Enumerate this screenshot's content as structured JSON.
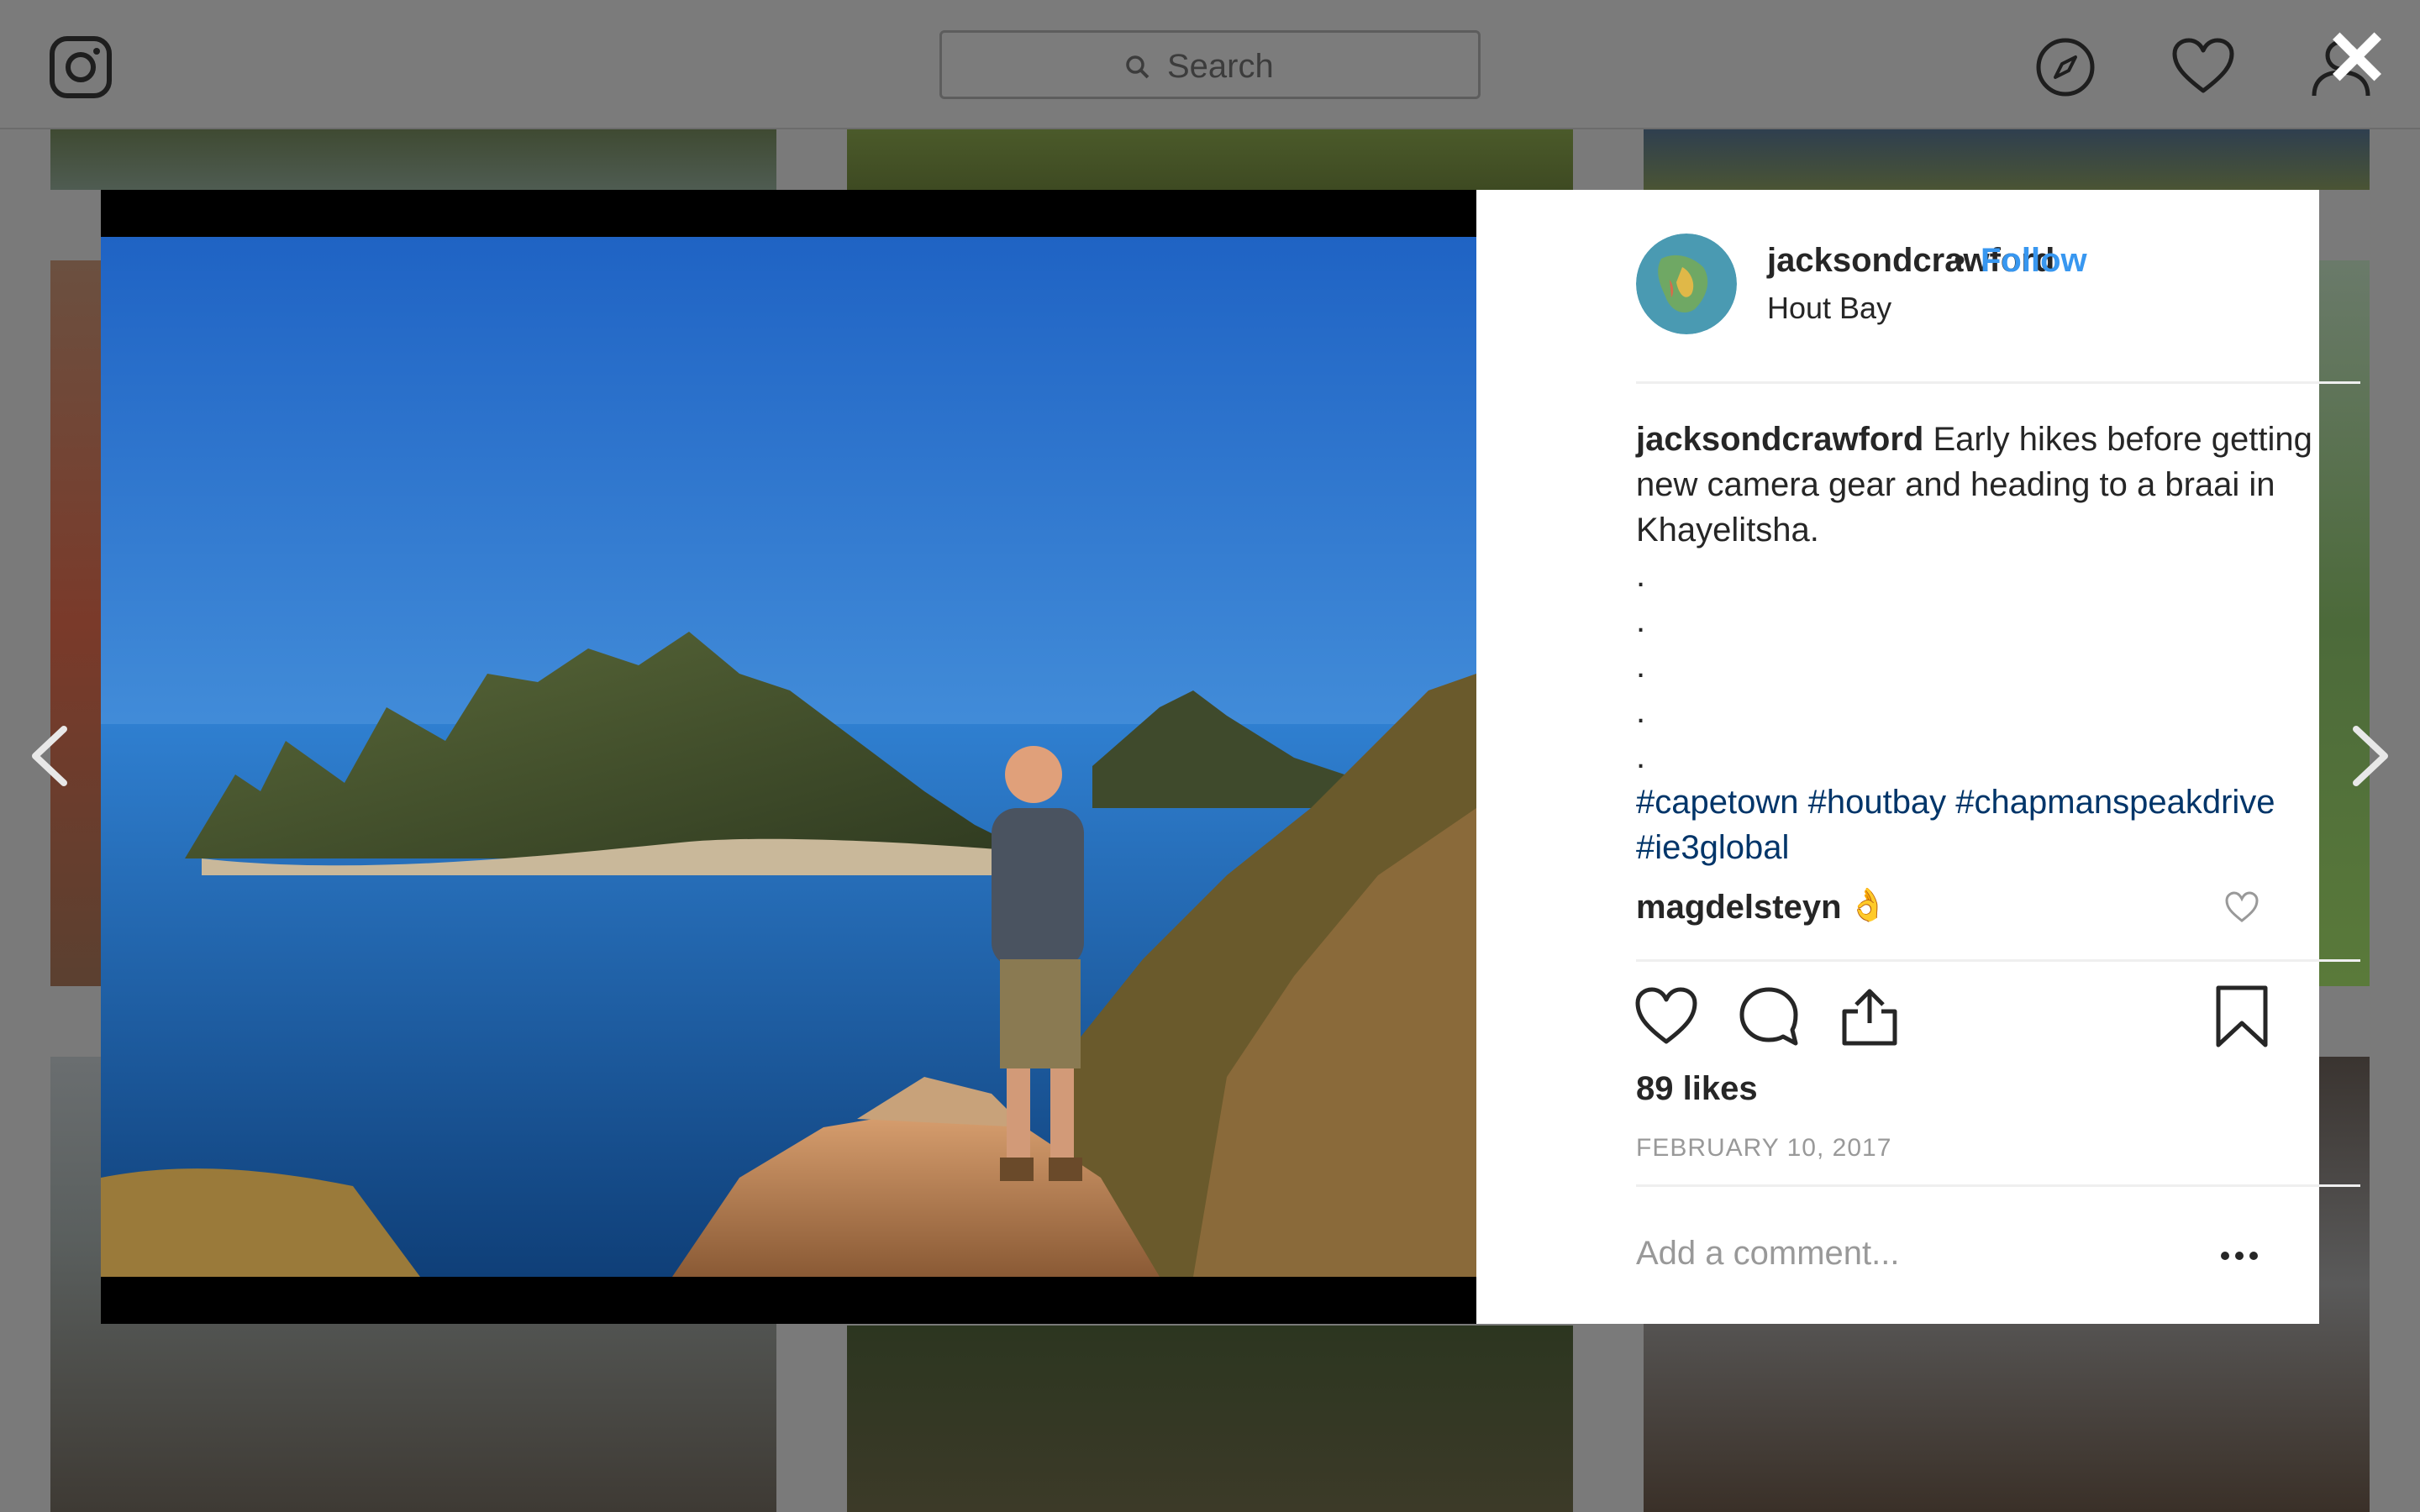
{
  "header": {
    "search_placeholder": "Search"
  },
  "post": {
    "username": "jacksondcrawford",
    "separator": "•",
    "follow_label": "Follow",
    "location": "Hout Bay",
    "caption_username": "jacksondcrawford",
    "caption_text": "Early hikes before getting new camera gear and heading to a braai in Khayelitsha.",
    "caption_dots": [
      ".",
      ".",
      ".",
      ".",
      "."
    ],
    "hashtags": "#capetown #houtbay #chapmanspeakdrive #ie3global",
    "comment": {
      "username": "magdelsteyn",
      "emoji": "👌"
    },
    "likes": "89 likes",
    "date": "FEBRUARY 10, 2017",
    "add_comment_placeholder": "Add a comment..."
  },
  "icons": {
    "logo": "instagram-icon",
    "explore": "compass-icon",
    "activity": "heart-icon",
    "profile": "user-icon",
    "close": "close-icon",
    "prev": "chevron-left-icon",
    "next": "chevron-right-icon",
    "like": "heart-icon",
    "comment": "comment-icon",
    "share": "share-icon",
    "save": "bookmark-icon",
    "more": "more-icon"
  },
  "colors": {
    "follow": "#3897f0",
    "hashtag": "#003569",
    "overlay": "#7a7a7a"
  }
}
